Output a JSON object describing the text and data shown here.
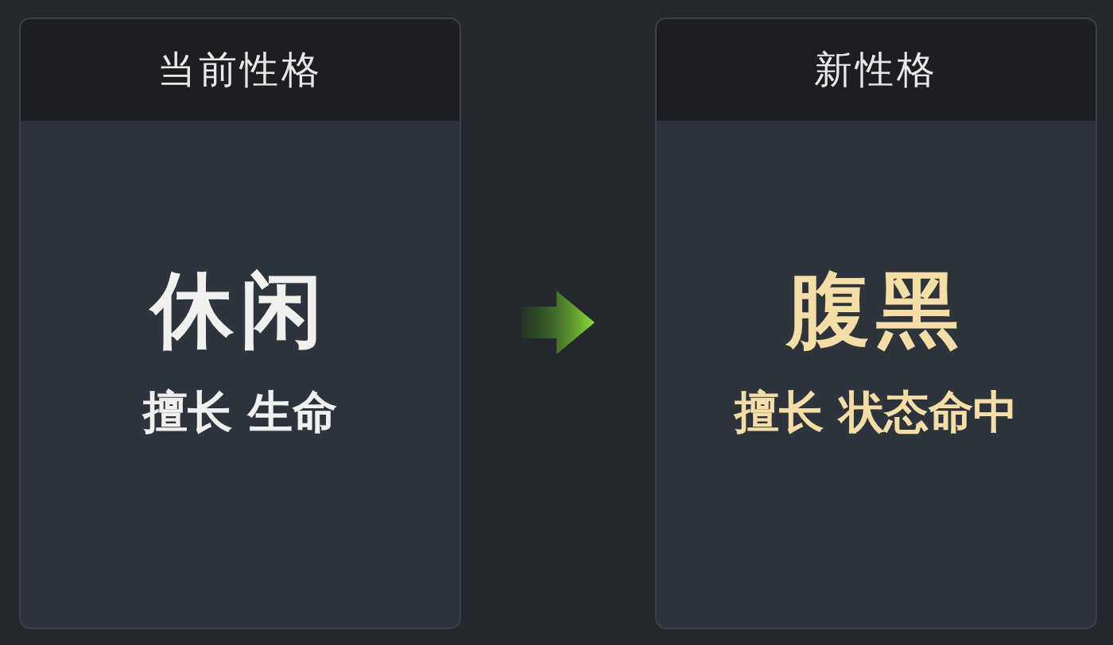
{
  "cards": [
    {
      "kind": "current",
      "title": "当前性格",
      "trait": "休闲",
      "specialty": "擅长 生命"
    },
    {
      "kind": "new",
      "title": "新性格",
      "trait": "腹黑",
      "specialty": "擅长 状态命中"
    }
  ]
}
